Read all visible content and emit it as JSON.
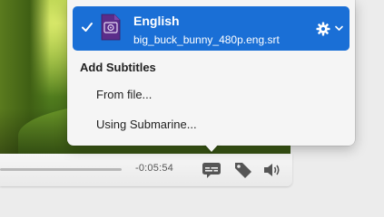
{
  "player": {
    "time_remaining": "-0:05:54"
  },
  "subtitle_popup": {
    "active_track": {
      "language": "English",
      "filename": "big_buck_bunny_480p.eng.srt",
      "selected": true
    },
    "add_section_title": "Add Subtitles",
    "add_options": [
      {
        "label": "From file..."
      },
      {
        "label": "Using Submarine..."
      }
    ]
  },
  "colors": {
    "accent": "#1a6fd6",
    "popup_bg": "#f5f5f5",
    "file_icon": "#5b2d8a"
  },
  "icons": {
    "subtitles": "subtitles-icon",
    "tag": "tag-icon",
    "volume": "volume-icon",
    "settings": "gear-icon"
  }
}
